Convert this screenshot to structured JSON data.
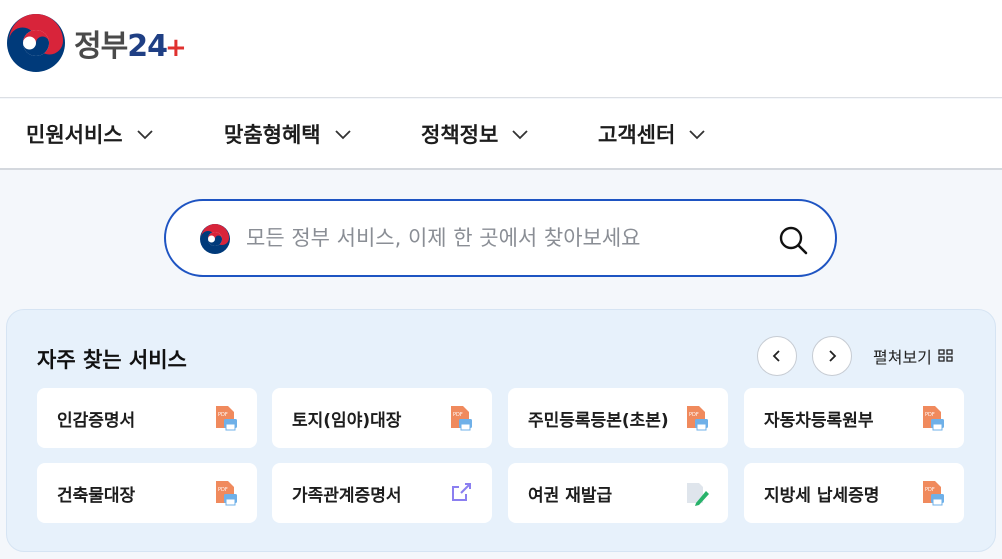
{
  "header": {
    "logo_text": "정부",
    "logo_num": "24",
    "logo_plus": "+"
  },
  "gnb": {
    "items": [
      {
        "label": "민원서비스"
      },
      {
        "label": "맞춤형혜택"
      },
      {
        "label": "정책정보"
      },
      {
        "label": "고객센터"
      }
    ]
  },
  "search": {
    "placeholder": "모든 정부 서비스, 이제 한 곳에서 찾아보세요"
  },
  "frequent": {
    "title": "자주 찾는 서비스",
    "expand_label": "펼쳐보기",
    "cards": [
      {
        "label": "인감증명서",
        "icon": "pdf-print-icon"
      },
      {
        "label": "토지(임야)대장",
        "icon": "pdf-print-icon"
      },
      {
        "label": "주민등록등본(초본)",
        "icon": "pdf-print-icon"
      },
      {
        "label": "자동차등록원부",
        "icon": "pdf-print-icon"
      },
      {
        "label": "건축물대장",
        "icon": "pdf-print-icon"
      },
      {
        "label": "가족관계증명서",
        "icon": "external-link-icon"
      },
      {
        "label": "여권 재발급",
        "icon": "document-edit-icon"
      },
      {
        "label": "지방세 납세증명",
        "icon": "pdf-print-icon"
      }
    ]
  },
  "colors": {
    "brand_blue": "#1e54c2",
    "panel_bg": "#e7f1fb",
    "pdf_orange": "#f08a5d",
    "link_purple": "#8b7ff0",
    "edit_green": "#28b26a"
  }
}
